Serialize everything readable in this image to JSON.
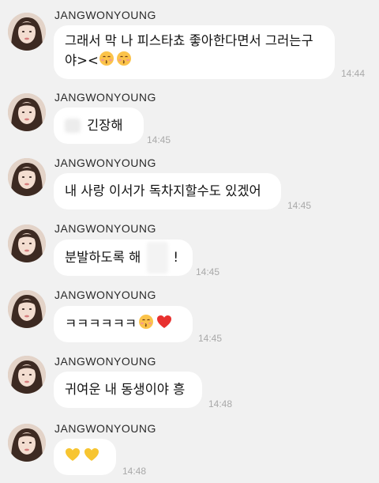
{
  "messages": [
    {
      "sender": "JANGWONYOUNG",
      "text_line1": "그래서 막 나 피스타쵸 좋아한다면서 그러는구",
      "text_line2": "야><",
      "emojis": [
        "kissing-blushing-emoji",
        "kissing-blushing-emoji"
      ],
      "time": "14:44"
    },
    {
      "sender": "JANGWONYOUNG",
      "text": "긴장해",
      "time": "14:45"
    },
    {
      "sender": "JANGWONYOUNG",
      "text": "내 사랑 이서가 독차지할수도 있겠어",
      "time": "14:45"
    },
    {
      "sender": "JANGWONYOUNG",
      "text": "분발하도록 해",
      "text_end": "!",
      "time": "14:45"
    },
    {
      "sender": "JANGWONYOUNG",
      "text": "ㅋㅋㅋㅋㅋㅋ",
      "emojis": [
        "kissing-blushing-emoji",
        "red-heart-emoji"
      ],
      "time": "14:45"
    },
    {
      "sender": "JANGWONYOUNG",
      "text": "귀여운 내 동생이야 흥",
      "time": "14:48"
    },
    {
      "sender": "JANGWONYOUNG",
      "emojis": [
        "yellow-heart-emoji",
        "yellow-heart-emoji"
      ],
      "time": "14:48"
    }
  ],
  "colors": {
    "background": "#f1f1f1",
    "bubble": "#ffffff",
    "timestamp": "#a9a9a9",
    "red_heart": "#e8312f",
    "yellow_heart": "#f7c531"
  }
}
